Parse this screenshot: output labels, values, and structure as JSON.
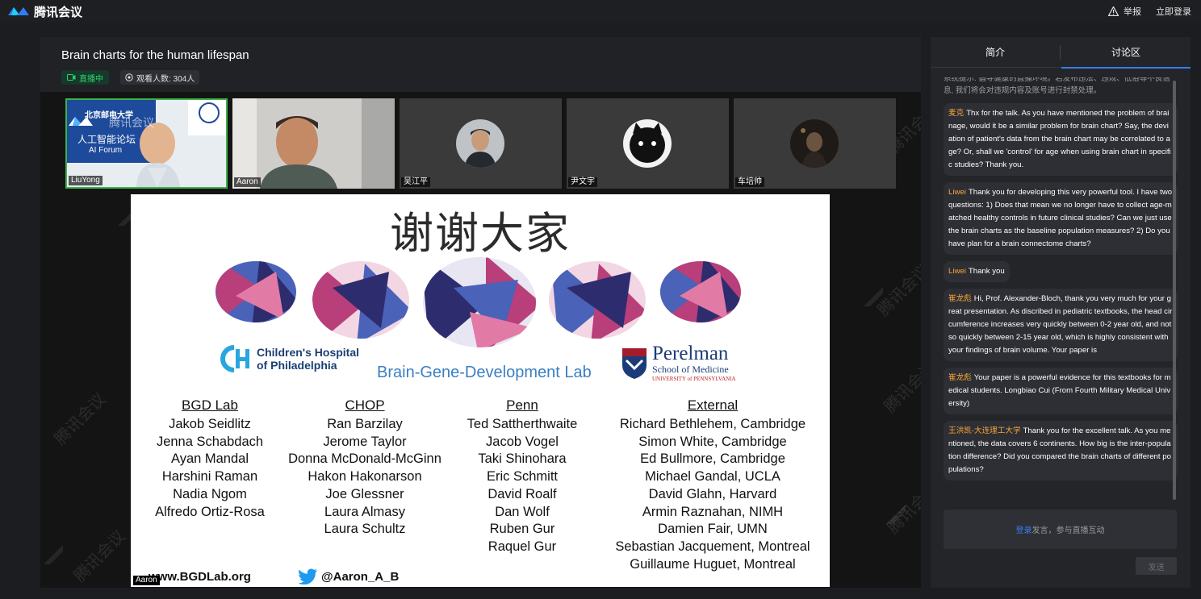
{
  "app": {
    "brand": "腾讯会议",
    "report_label": "举报",
    "login_label": "立即登录"
  },
  "stream": {
    "title": "Brain charts for the human lifespan",
    "live_label": "直播中",
    "viewers_label": "观看人数: 304人"
  },
  "participants": [
    {
      "name": "LiuYong"
    },
    {
      "name": "Aaron"
    },
    {
      "name": "吴江平"
    },
    {
      "name": "尹文宇"
    },
    {
      "name": "车培帅"
    }
  ],
  "tile1": {
    "forum_cn": "人工智能论坛",
    "forum_en": "AI Forum",
    "wm": "腾讯会议",
    "school": "北京邮电大学"
  },
  "watermark": "腾讯会议",
  "slide": {
    "title": "谢谢大家",
    "chop_line1": "Children's Hospital",
    "chop_line2": "of Philadelphia",
    "bgd_lab": "Brain-Gene-Development Lab",
    "penn_1": "Perelman",
    "penn_2": "School of Medicine",
    "penn_3": "UNIVERSITY of PENNSYLVANIA",
    "website": "www.BGDLab.org",
    "twitter": "@Aaron_A_B",
    "columns": [
      {
        "heading": "BGD Lab",
        "names": [
          "Jakob Seidlitz",
          "Jenna Schabdach",
          "Ayan Mandal",
          "Harshini Raman",
          "Nadia Ngom",
          "Alfredo Ortiz-Rosa"
        ]
      },
      {
        "heading": "CHOP",
        "names": [
          "Ran Barzilay",
          "Jerome Taylor",
          "Donna McDonald-McGinn",
          "Hakon Hakonarson",
          "Joe Glessner",
          "Laura Almasy",
          "Laura Schultz"
        ]
      },
      {
        "heading": "Penn",
        "names": [
          "Ted Sattherthwaite",
          "Jacob Vogel",
          "Taki Shinohara",
          "Eric Schmitt",
          "David Roalf",
          "Dan Wolf",
          "Ruben Gur",
          "Raquel Gur"
        ]
      },
      {
        "heading": "External",
        "names": [
          "Richard Bethlehem, Cambridge",
          "Simon White, Cambridge",
          "Ed Bullmore, Cambridge",
          "Michael Gandal, UCLA",
          "David Glahn, Harvard",
          "Armin Raznahan, NIMH",
          "Damien Fair, UMN",
          "Sebastian Jacquement, Montreal",
          "Guillaume Huguet, Montreal"
        ]
      }
    ]
  },
  "speaker_tag": "Aaron",
  "sidebar": {
    "tab_intro": "简介",
    "tab_discussion": "讨论区",
    "system_notice": "系统提示: 倡导健康的直播环境。若发布违法、违规、低俗等不良信息, 我们将会对违规内容及账号进行封禁处理。",
    "messages": [
      {
        "user": "麦克",
        "text": "Thx for the talk. As you have mentioned the problem of brainage, would it be a similar problem for brain chart? Say, the deviation of patient's data from the brain chart may be correlated to age? Or, shall we 'control' for age when using brain chart in specific studies? Thank you."
      },
      {
        "user": "Liwei",
        "text": "Thank you for developing this very powerful tool. I have two questions: 1) Does that mean we no longer have to collect age-matched healthy controls in future clinical studies? Can we just use the brain charts as the baseline population measures? 2) Do you have plan for a brain connectome charts?"
      },
      {
        "user": "Liwei",
        "text": "Thank you"
      },
      {
        "user": "崔龙彪",
        "text": "Hi, Prof. Alexander-Bloch, thank you very much for your great presentation. As discribed in pediatric textbooks, the head circumference increases very quickly between 0-2 year old, and not so quickly between 2-15 year old, which is highly consistent with your findings of brain volume. Your paper is"
      },
      {
        "user": "崔龙彪",
        "text": "Your paper is a powerful evidence for this textbooks for medical students. Longbiao Cui (From Fourth Military Medical University)"
      },
      {
        "user": "王洪凯-大连理工大学",
        "text": "Thank you for the excellent talk. As you mentioned, the data covers 6 continents. How big is the inter-population difference? Did you compared the brain charts of different populations?"
      }
    ],
    "login_link": "登录",
    "login_rest": "发言，参与直播互动",
    "send_label": "发送"
  }
}
